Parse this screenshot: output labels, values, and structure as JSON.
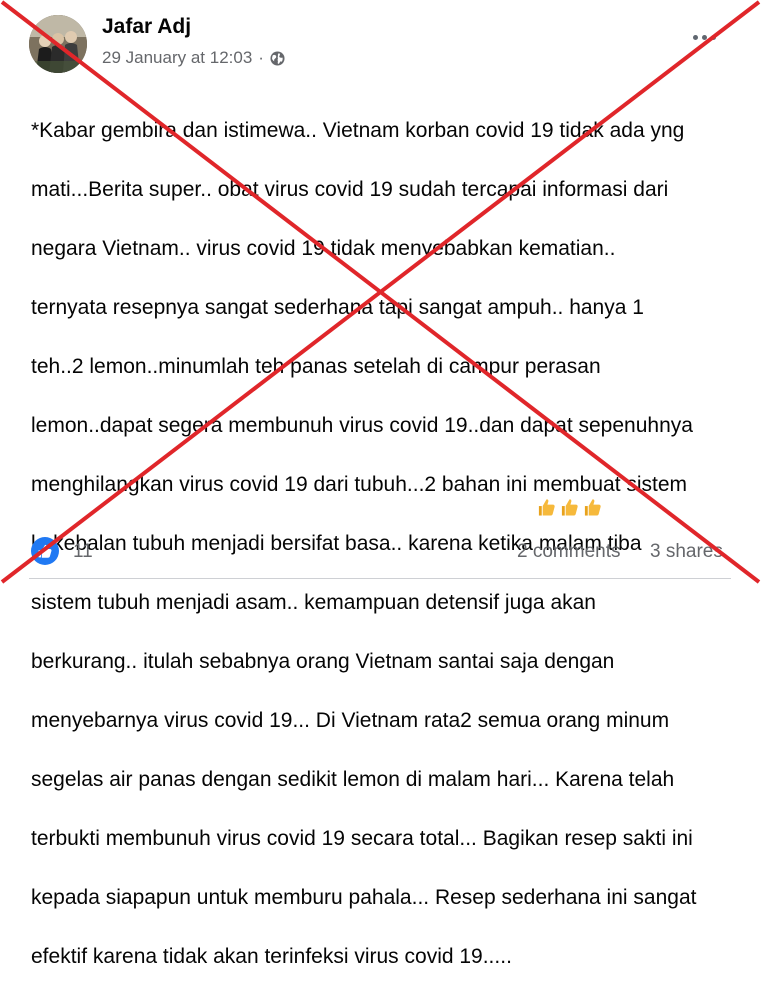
{
  "post": {
    "author": "Jafar Adj",
    "timestamp": "29 January at 12:03",
    "separator": "·",
    "audience_icon": "globe-icon",
    "more_icon": "more-options-icon",
    "body_lines": [
      "*Kabar gembira dan istimewa.. Vietnam korban covid 19 tidak ada yng",
      "mati...Berita super.. obat virus covid 19  sudah tercapai informasi dari",
      "negara Vietnam.. virus covid 19 tidak menyebabkan kematian..",
      "ternyata resepnya sangat sederhana tapi sangat ampuh.. hanya 1",
      "teh..2 lemon..minumlah teh panas setelah di campur perasan",
      "lemon..dapat segera membunuh virus covid 19..dan dapat sepenuhnya",
      "menghilangkan virus covid 19 dari tubuh...2 bahan ini membuat sistem",
      "kekebalan tubuh menjadi bersifat basa.. karena ketika malam tiba",
      "sistem tubuh menjadi asam.. kemampuan detensif juga akan",
      "berkurang.. itulah sebabnya orang Vietnam santai saja dengan",
      "menyebarnya virus covid 19... Di Vietnam rata2 semua orang minum",
      "segelas air panas dengan sedikit lemon di malam hari... Karena telah",
      "terbukti membunuh virus covid 19 secara total... Bagikan resep sakti ini",
      "kepada siapapun untuk memburu pahala... Resep sederhana ini sangat",
      "efektif karena tidak akan terinfeksi virus covid 19....."
    ],
    "emoji": [
      "👍",
      "👍",
      "👍"
    ]
  },
  "footer": {
    "reaction_icon": "like-icon",
    "reaction_count": "11",
    "comments": "2 comments",
    "shares": "3 shares"
  },
  "overlay": {
    "type": "red-cross",
    "color": "#e0262a"
  },
  "colors": {
    "text": "#050505",
    "secondary": "#65676b",
    "like_blue": "#2079f3",
    "thumb_yellow": "#f6b93b"
  }
}
